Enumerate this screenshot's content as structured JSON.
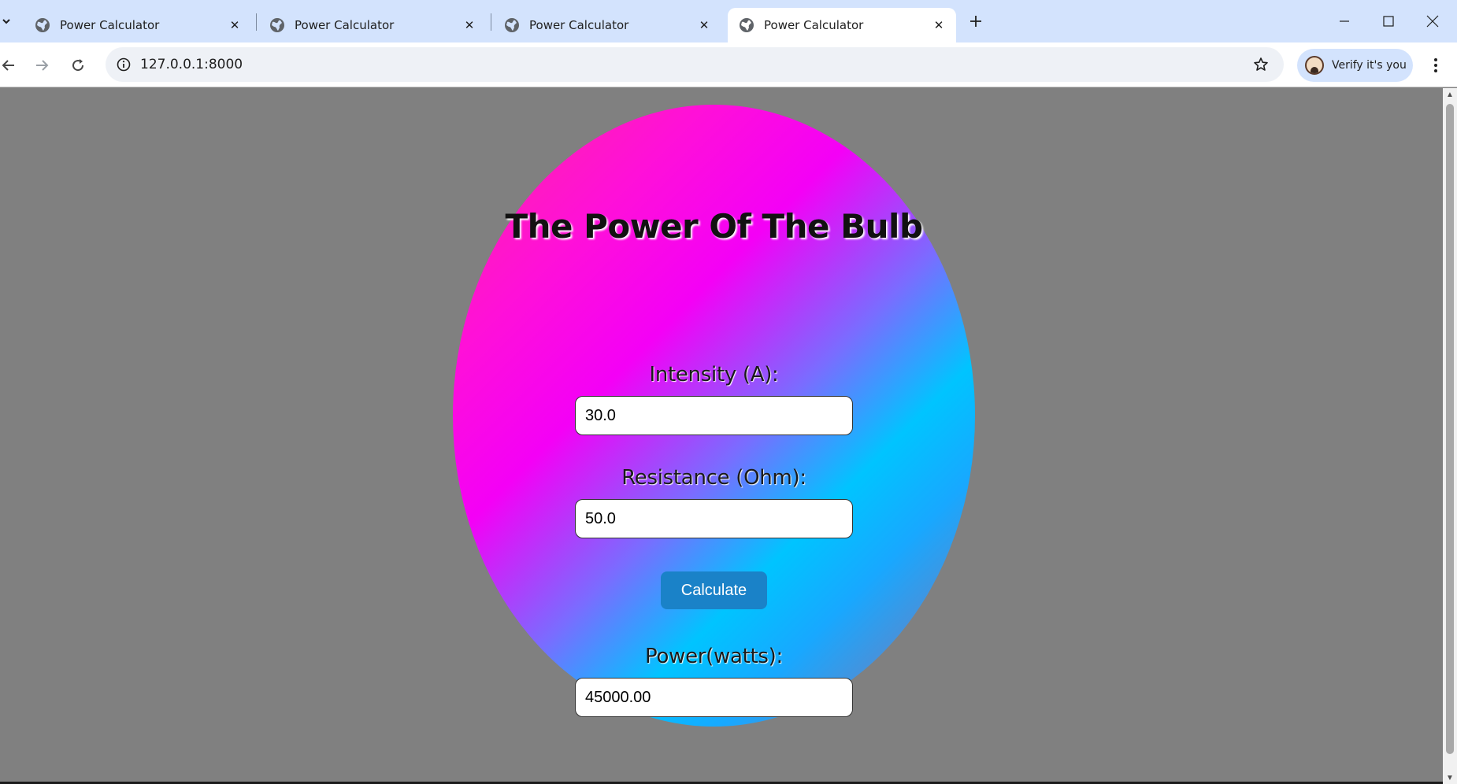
{
  "browser": {
    "tabs": [
      {
        "title": "Power Calculator",
        "active": false
      },
      {
        "title": "Power Calculator",
        "active": false
      },
      {
        "title": "Power Calculator",
        "active": false
      },
      {
        "title": "Power Calculator",
        "active": true
      }
    ],
    "address_bar": {
      "url": "127.0.0.1:8000"
    },
    "profile_button": {
      "label": "Verify it's you"
    },
    "icons": [
      "tab-list-chevron",
      "globe",
      "close",
      "new-tab-plus",
      "minimize",
      "maximize",
      "close-window",
      "back-arrow",
      "forward-arrow",
      "reload",
      "site-info",
      "bookmark-star",
      "avatar",
      "kebab-menu"
    ]
  },
  "page": {
    "title": "The Power Of The Bulb",
    "intensity": {
      "label": "Intensity (A):",
      "value": "30.0"
    },
    "resistance": {
      "label": "Resistance (Ohm):",
      "value": "50.0"
    },
    "calculate_button": {
      "label": "Calculate"
    },
    "power": {
      "label": "Power(watts):",
      "value": "45000.00"
    },
    "colors": {
      "page_background": "#808080",
      "button": "#1a82c8",
      "gradient": [
        "#ff2aa0",
        "#f400f6",
        "#00c4ff",
        "#9a6a9c"
      ]
    }
  }
}
